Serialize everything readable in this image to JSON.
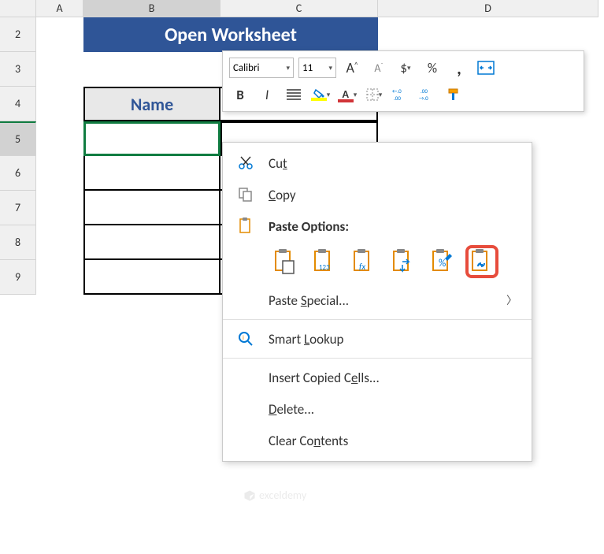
{
  "columns": {
    "A": "A",
    "B": "B",
    "C": "C",
    "D": "D"
  },
  "rows": {
    "r2": "2",
    "r3": "3",
    "r4": "4",
    "r5": "5",
    "r6": "6",
    "r7": "7",
    "r8": "8",
    "r9": "9"
  },
  "worksheet": {
    "title": "Open Worksheet",
    "name_header": "Name"
  },
  "mini_toolbar": {
    "font_name": "Calibri",
    "font_size": "11",
    "increase_font": "A",
    "decrease_font": "A",
    "currency": "$",
    "percent": "%",
    "comma": ",",
    "bold": "B",
    "italic": "I",
    "fill_letter": "A",
    "font_color_letter": "A",
    "inc_decimal": "←.0\n.00",
    "dec_decimal": ".00\n→.0"
  },
  "context_menu": {
    "cut": "Cut",
    "copy": "Copy",
    "paste_options": "Paste Options:",
    "paste_special": "Paste Special...",
    "smart_lookup": "Smart Lookup",
    "insert_copied": "Insert Copied Cells...",
    "delete": "Delete...",
    "clear_contents": "Clear Contents"
  },
  "watermark": "exceldemy"
}
